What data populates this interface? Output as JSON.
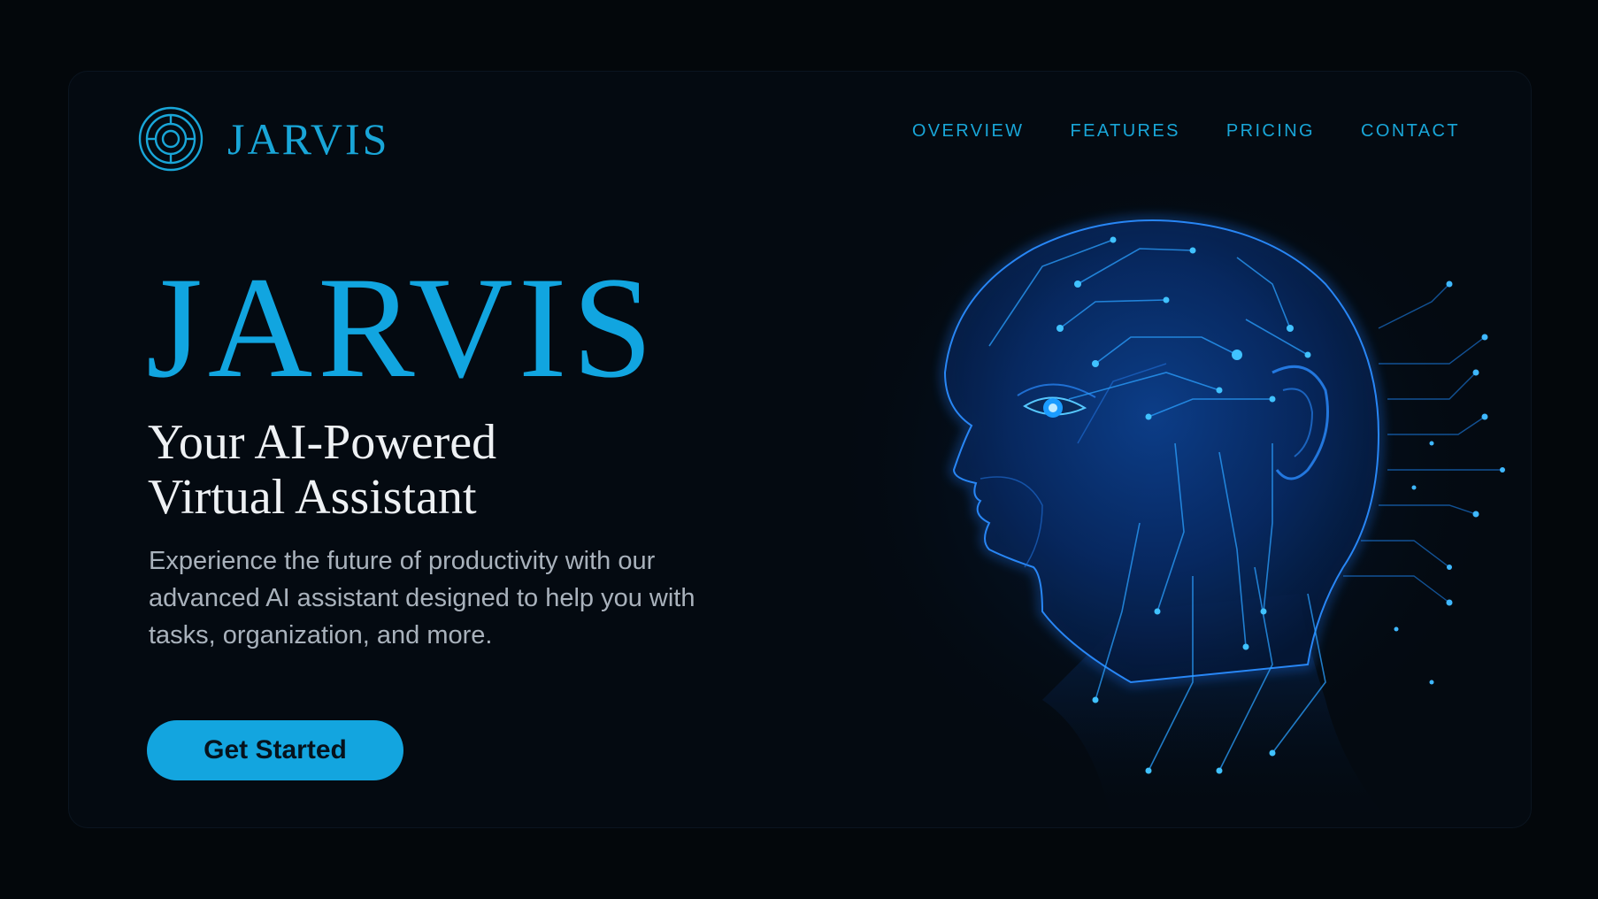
{
  "brand": {
    "name": "JARVIS",
    "accent_color": "#13a5df",
    "logo_icon": "target-rings-logo-icon"
  },
  "nav": {
    "items": [
      {
        "label": "OVERVIEW"
      },
      {
        "label": "FEATURES"
      },
      {
        "label": "PRICING"
      },
      {
        "label": "CONTACT"
      }
    ]
  },
  "hero": {
    "title": "JARVIS",
    "subtitle_line1": "Your AI-Powered",
    "subtitle_line2": "Virtual Assistant",
    "description": "Experience the future of productivity with our advanced AI assistant designed to help you with tasks, organization, and more.",
    "cta_label": "Get Started",
    "illustration": "ai-head-circuit-illustration"
  },
  "colors": {
    "background": "#03070b",
    "panel": "#040a11",
    "heading_text": "#eef1f4",
    "body_text": "#a9b2bc",
    "glow": "#1e7dff"
  }
}
